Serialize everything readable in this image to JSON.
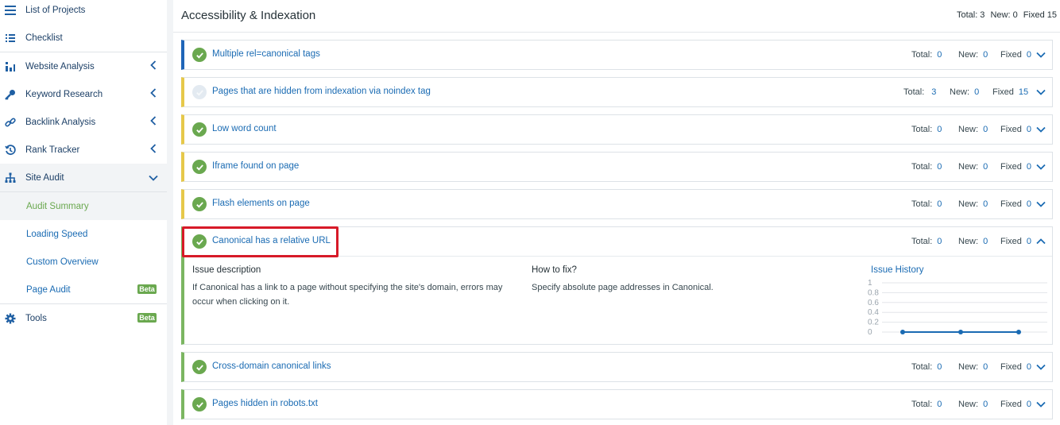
{
  "sidebar": {
    "items": [
      {
        "label": "List of Projects"
      },
      {
        "label": "Checklist"
      },
      {
        "label": "Website Analysis"
      },
      {
        "label": "Keyword Research"
      },
      {
        "label": "Backlink Analysis"
      },
      {
        "label": "Rank Tracker"
      },
      {
        "label": "Site Audit"
      },
      {
        "label": "Tools",
        "badge": "Beta"
      }
    ],
    "site_audit_children": [
      {
        "label": "Audit Summary"
      },
      {
        "label": "Loading Speed"
      },
      {
        "label": "Custom Overview"
      },
      {
        "label": "Page Audit",
        "badge": "Beta"
      }
    ]
  },
  "header": {
    "title": "Accessibility & Indexation",
    "total_label": "Total: 3",
    "new_label": "New: 0",
    "fixed_label": "Fixed 15"
  },
  "labels": {
    "total": "Total:",
    "new": "New:",
    "fixed": "Fixed"
  },
  "issues": [
    {
      "title": "Multiple rel=canonical tags",
      "total": "0",
      "new": "0",
      "fixed": "0"
    },
    {
      "title": "Pages that are hidden from indexation via noindex tag",
      "total": "3",
      "new": "0",
      "fixed": "15"
    },
    {
      "title": "Low word count",
      "total": "0",
      "new": "0",
      "fixed": "0"
    },
    {
      "title": "Iframe found on page",
      "total": "0",
      "new": "0",
      "fixed": "0"
    },
    {
      "title": "Flash elements on page",
      "total": "0",
      "new": "0",
      "fixed": "0"
    },
    {
      "title": "Canonical has a relative URL",
      "total": "0",
      "new": "0",
      "fixed": "0"
    },
    {
      "title": "Cross-domain canonical links",
      "total": "0",
      "new": "0",
      "fixed": "0"
    },
    {
      "title": "Pages hidden in robots.txt",
      "total": "0",
      "new": "0",
      "fixed": "0"
    }
  ],
  "expanded": {
    "desc_heading": "Issue description",
    "desc_text": "If Canonical has a link to a page without specifying the site's domain, errors may occur when clicking on it.",
    "fix_heading": "How to fix?",
    "fix_text": "Specify absolute page addresses in Canonical.",
    "history_label": "Issue History"
  },
  "chart_data": {
    "type": "line",
    "title": "Issue History",
    "y_ticks": [
      "1",
      "0.8",
      "0.6",
      "0.4",
      "0.2",
      "0"
    ],
    "ylim": [
      0,
      1
    ],
    "series": [
      {
        "values": [
          0,
          0,
          0
        ]
      }
    ],
    "color": "#1a6bb3"
  },
  "colors": {
    "accent_blue": "#1a6bb3",
    "ok_green": "#6aa84f",
    "warn_yellow": "#e6c84a",
    "highlight_red": "#d71a28"
  }
}
